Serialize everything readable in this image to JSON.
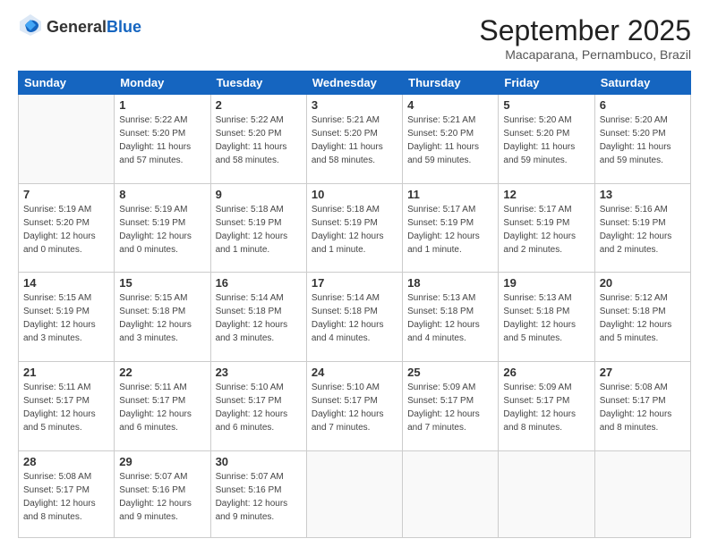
{
  "logo": {
    "general": "General",
    "blue": "Blue"
  },
  "title": "September 2025",
  "subtitle": "Macaparana, Pernambuco, Brazil",
  "headers": [
    "Sunday",
    "Monday",
    "Tuesday",
    "Wednesday",
    "Thursday",
    "Friday",
    "Saturday"
  ],
  "weeks": [
    [
      {
        "day": "",
        "info": ""
      },
      {
        "day": "1",
        "info": "Sunrise: 5:22 AM\nSunset: 5:20 PM\nDaylight: 11 hours\nand 57 minutes."
      },
      {
        "day": "2",
        "info": "Sunrise: 5:22 AM\nSunset: 5:20 PM\nDaylight: 11 hours\nand 58 minutes."
      },
      {
        "day": "3",
        "info": "Sunrise: 5:21 AM\nSunset: 5:20 PM\nDaylight: 11 hours\nand 58 minutes."
      },
      {
        "day": "4",
        "info": "Sunrise: 5:21 AM\nSunset: 5:20 PM\nDaylight: 11 hours\nand 59 minutes."
      },
      {
        "day": "5",
        "info": "Sunrise: 5:20 AM\nSunset: 5:20 PM\nDaylight: 11 hours\nand 59 minutes."
      },
      {
        "day": "6",
        "info": "Sunrise: 5:20 AM\nSunset: 5:20 PM\nDaylight: 11 hours\nand 59 minutes."
      }
    ],
    [
      {
        "day": "7",
        "info": "Sunrise: 5:19 AM\nSunset: 5:20 PM\nDaylight: 12 hours\nand 0 minutes."
      },
      {
        "day": "8",
        "info": "Sunrise: 5:19 AM\nSunset: 5:19 PM\nDaylight: 12 hours\nand 0 minutes."
      },
      {
        "day": "9",
        "info": "Sunrise: 5:18 AM\nSunset: 5:19 PM\nDaylight: 12 hours\nand 1 minute."
      },
      {
        "day": "10",
        "info": "Sunrise: 5:18 AM\nSunset: 5:19 PM\nDaylight: 12 hours\nand 1 minute."
      },
      {
        "day": "11",
        "info": "Sunrise: 5:17 AM\nSunset: 5:19 PM\nDaylight: 12 hours\nand 1 minute."
      },
      {
        "day": "12",
        "info": "Sunrise: 5:17 AM\nSunset: 5:19 PM\nDaylight: 12 hours\nand 2 minutes."
      },
      {
        "day": "13",
        "info": "Sunrise: 5:16 AM\nSunset: 5:19 PM\nDaylight: 12 hours\nand 2 minutes."
      }
    ],
    [
      {
        "day": "14",
        "info": "Sunrise: 5:15 AM\nSunset: 5:19 PM\nDaylight: 12 hours\nand 3 minutes."
      },
      {
        "day": "15",
        "info": "Sunrise: 5:15 AM\nSunset: 5:18 PM\nDaylight: 12 hours\nand 3 minutes."
      },
      {
        "day": "16",
        "info": "Sunrise: 5:14 AM\nSunset: 5:18 PM\nDaylight: 12 hours\nand 3 minutes."
      },
      {
        "day": "17",
        "info": "Sunrise: 5:14 AM\nSunset: 5:18 PM\nDaylight: 12 hours\nand 4 minutes."
      },
      {
        "day": "18",
        "info": "Sunrise: 5:13 AM\nSunset: 5:18 PM\nDaylight: 12 hours\nand 4 minutes."
      },
      {
        "day": "19",
        "info": "Sunrise: 5:13 AM\nSunset: 5:18 PM\nDaylight: 12 hours\nand 5 minutes."
      },
      {
        "day": "20",
        "info": "Sunrise: 5:12 AM\nSunset: 5:18 PM\nDaylight: 12 hours\nand 5 minutes."
      }
    ],
    [
      {
        "day": "21",
        "info": "Sunrise: 5:11 AM\nSunset: 5:17 PM\nDaylight: 12 hours\nand 5 minutes."
      },
      {
        "day": "22",
        "info": "Sunrise: 5:11 AM\nSunset: 5:17 PM\nDaylight: 12 hours\nand 6 minutes."
      },
      {
        "day": "23",
        "info": "Sunrise: 5:10 AM\nSunset: 5:17 PM\nDaylight: 12 hours\nand 6 minutes."
      },
      {
        "day": "24",
        "info": "Sunrise: 5:10 AM\nSunset: 5:17 PM\nDaylight: 12 hours\nand 7 minutes."
      },
      {
        "day": "25",
        "info": "Sunrise: 5:09 AM\nSunset: 5:17 PM\nDaylight: 12 hours\nand 7 minutes."
      },
      {
        "day": "26",
        "info": "Sunrise: 5:09 AM\nSunset: 5:17 PM\nDaylight: 12 hours\nand 8 minutes."
      },
      {
        "day": "27",
        "info": "Sunrise: 5:08 AM\nSunset: 5:17 PM\nDaylight: 12 hours\nand 8 minutes."
      }
    ],
    [
      {
        "day": "28",
        "info": "Sunrise: 5:08 AM\nSunset: 5:17 PM\nDaylight: 12 hours\nand 8 minutes."
      },
      {
        "day": "29",
        "info": "Sunrise: 5:07 AM\nSunset: 5:16 PM\nDaylight: 12 hours\nand 9 minutes."
      },
      {
        "day": "30",
        "info": "Sunrise: 5:07 AM\nSunset: 5:16 PM\nDaylight: 12 hours\nand 9 minutes."
      },
      {
        "day": "",
        "info": ""
      },
      {
        "day": "",
        "info": ""
      },
      {
        "day": "",
        "info": ""
      },
      {
        "day": "",
        "info": ""
      }
    ]
  ]
}
